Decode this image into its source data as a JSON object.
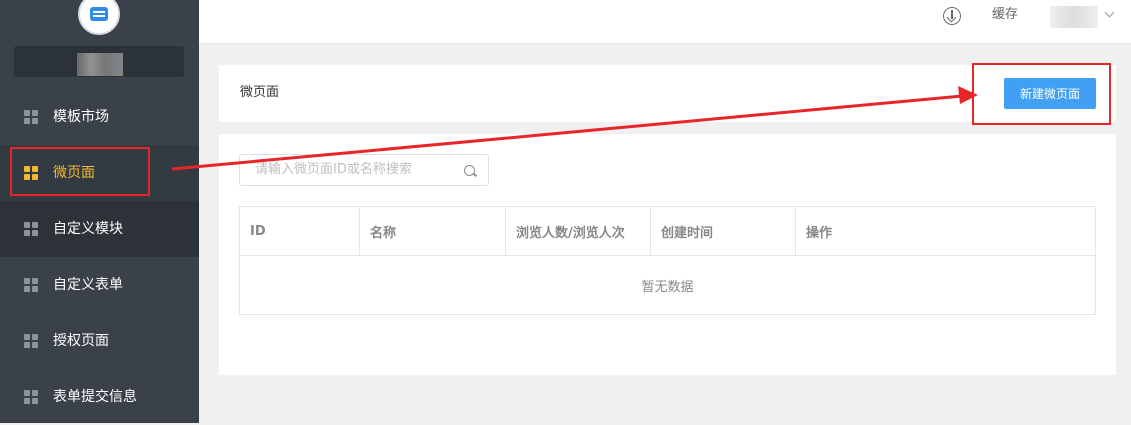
{
  "sidebar": {
    "items": [
      {
        "label": "模板市场"
      },
      {
        "label": "微页面"
      },
      {
        "label": "自定义模块"
      },
      {
        "label": "自定义表单"
      },
      {
        "label": "授权页面"
      },
      {
        "label": "表单提交信息"
      }
    ]
  },
  "topbar": {
    "cache_label": "缓存"
  },
  "header": {
    "title": "微页面",
    "new_button_label": "新建微页面"
  },
  "search": {
    "placeholder": "请输入微页面ID或名称搜索"
  },
  "table": {
    "columns": [
      "ID",
      "名称",
      "浏览人数/浏览人次",
      "创建时间",
      "操作"
    ],
    "empty_text": "暂无数据"
  },
  "colors": {
    "accent": "#42a0f4",
    "active_nav": "#f5b92f",
    "annotation": "#e8262a",
    "sidebar_bg": "#3a4149"
  },
  "icons": [
    "logo-icon",
    "grid-icon",
    "download-icon",
    "chevron-down-icon",
    "search-icon"
  ]
}
